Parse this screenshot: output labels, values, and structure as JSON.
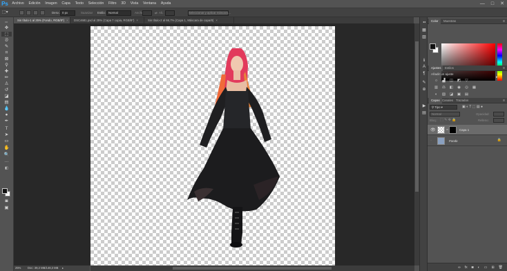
{
  "app": {
    "logo": "Ps"
  },
  "menu": [
    "Archivo",
    "Edición",
    "Imagen",
    "Capa",
    "Texto",
    "Selección",
    "Filtro",
    "3D",
    "Vista",
    "Ventana",
    "Ayuda"
  ],
  "window_controls": {
    "minimize": "—",
    "maximize": "□",
    "close": "✕"
  },
  "options_bar": {
    "desvan_label": "Desv.:",
    "desvan_value": "0 px",
    "suavizar_label": "Suavizar",
    "estilo_label": "Estilo:",
    "estilo_value": "Normal",
    "anchura_label": "Anchu:",
    "altura_label": "Alt.:",
    "mask_button": "Seleccionar y aplicar máscara..."
  },
  "tabs": [
    {
      "label": "Sin título-1 al 25% (Fondo, RGB/8*)",
      "close": "×"
    },
    {
      "label": "DSC4681.psd al 25% (Capa 7 copia, RGB/8*)",
      "close": "×"
    },
    {
      "label": "Sin título-2 al 66,7% (Capa 1, Máscara de capa/8)",
      "close": "×"
    }
  ],
  "status": {
    "zoom": "25%",
    "doc": "Doc: 39,2 MB/148,3 MB"
  },
  "color_panel": {
    "tabs": [
      "Color",
      "Muestras"
    ],
    "colors": {
      "fg": "#111111",
      "bg": "#ffffff"
    }
  },
  "adjustments_panel": {
    "tabs": [
      "Ajustes",
      "Estilos"
    ],
    "title": "Añadir un ajuste"
  },
  "layers_panel": {
    "tabs": [
      "Capas",
      "Canales",
      "Trazados"
    ],
    "filter": "Tipo",
    "blend_mode": "Normal",
    "opacity_label": "Opacidad:",
    "lock_label": "Bloq.:",
    "fill_label": "Relleno:",
    "layers": [
      {
        "name": "Capa 1"
      },
      {
        "name": "Fondo"
      }
    ]
  }
}
